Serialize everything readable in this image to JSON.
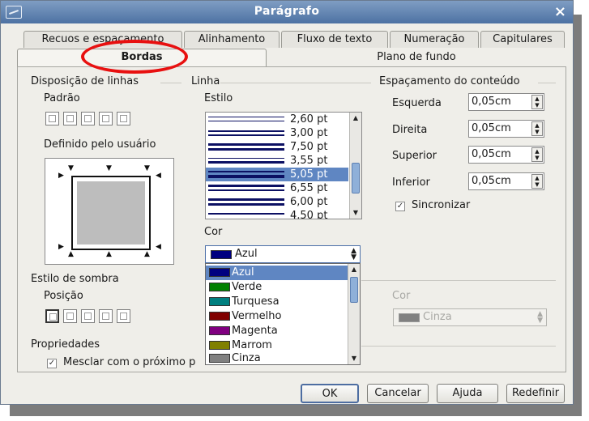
{
  "window": {
    "title": "Parágrafo",
    "close_icon": "×"
  },
  "tabs": {
    "row1": [
      "Recuos e espaçamento",
      "Alinhamento",
      "Fluxo de texto",
      "Numeração",
      "Capitulares"
    ],
    "row2": [
      "Bordas",
      "Plano de fundo"
    ]
  },
  "disposicao": {
    "title": "Disposição de linhas",
    "padrao_label": "Padrão",
    "definido_label": "Definido pelo usuário"
  },
  "linha": {
    "title": "Linha",
    "estilo_label": "Estilo",
    "styles": [
      "2,60 pt",
      "3,00 pt",
      "7,50 pt",
      "3,55 pt",
      "5,05 pt",
      "6,55 pt",
      "6,00 pt",
      "4,50 pt"
    ],
    "selected_style": "5,05 pt",
    "cor_label": "Cor",
    "cor_value": "Azul",
    "colors": [
      {
        "name": "Azul",
        "hex": "#000080"
      },
      {
        "name": "Verde",
        "hex": "#008000"
      },
      {
        "name": "Turquesa",
        "hex": "#008080"
      },
      {
        "name": "Vermelho",
        "hex": "#800000"
      },
      {
        "name": "Magenta",
        "hex": "#800080"
      },
      {
        "name": "Marrom",
        "hex": "#808000"
      },
      {
        "name": "Cinza",
        "hex": "#808080"
      }
    ]
  },
  "espacamento": {
    "title": "Espaçamento do conteúdo",
    "esquerda": {
      "label": "Esquerda",
      "value": "0,05cm"
    },
    "direita": {
      "label": "Direita",
      "value": "0,05cm"
    },
    "superior": {
      "label": "Superior",
      "value": "0,05cm"
    },
    "inferior": {
      "label": "Inferior",
      "value": "0,05cm"
    },
    "sincronizar": "Sincronizar"
  },
  "sombra": {
    "title": "Estilo de sombra",
    "posicao_label": "Posição",
    "cor_label": "Cor",
    "cor_value": "Cinza",
    "cor_hex": "#808080"
  },
  "propriedades": {
    "title": "Propriedades",
    "mesclar": "Mesclar com o próximo p"
  },
  "buttons": {
    "ok": "OK",
    "cancel": "Cancelar",
    "help": "Ajuda",
    "reset": "Redefinir"
  },
  "colors": {
    "title_bar": "#5b7fb0",
    "selection": "#5f86c2",
    "annotation": "#e81010"
  }
}
